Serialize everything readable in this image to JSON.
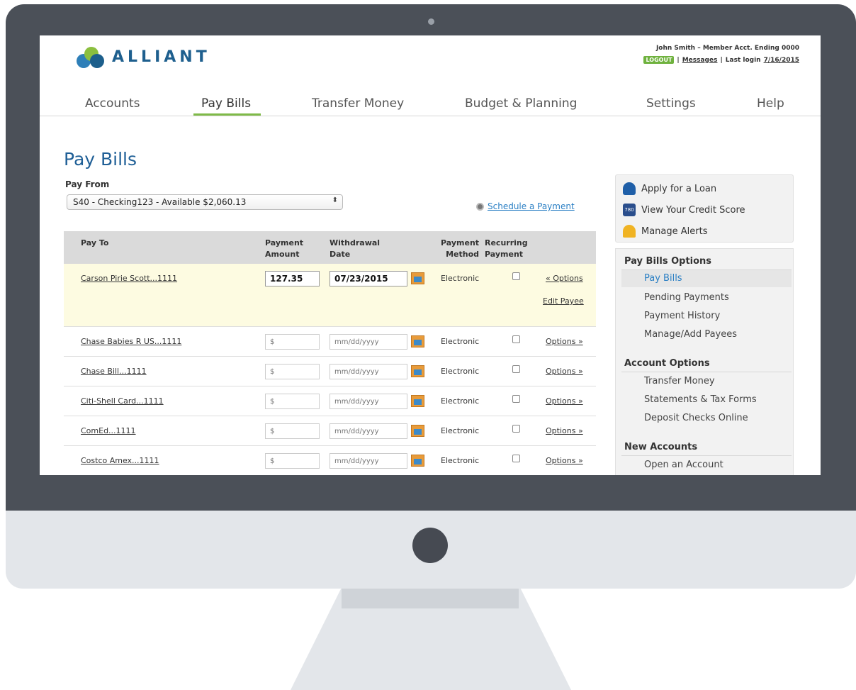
{
  "header": {
    "logo_text": "ALLIANT",
    "user_line": "John Smith – Member Acct. Ending 0000",
    "logout_label": "LOGOUT",
    "sep1": "|",
    "messages_label": "Messages",
    "sep2": "|",
    "last_login_label": "Last login",
    "last_login_date": "7/16/2015"
  },
  "nav": {
    "items": [
      "Accounts",
      "Pay Bills",
      "Transfer Money",
      "Budget & Planning",
      "Settings",
      "Help"
    ],
    "active": "Pay Bills"
  },
  "main": {
    "title": "Pay Bills",
    "pay_from_label": "Pay From",
    "pay_from_value": "S40 - Checking123 - Available $2,060.13",
    "select_arrow": "⬍",
    "schedule_label": "Schedule a Payment"
  },
  "table": {
    "headers": {
      "pay_to": "Pay To",
      "amount_1": "Payment",
      "amount_2": "Amount",
      "date_1": "Withdrawal",
      "date_2": "Date",
      "method_1": "Payment",
      "method_2": "Method",
      "recurring_1": "Recurring",
      "recurring_2": "Payment"
    },
    "amount_placeholder": "$",
    "date_placeholder": "mm/dd/yyyy",
    "rows": [
      {
        "payee": "Carson Pirie Scott...1111",
        "amount": "127.35",
        "date": "07/23/2015",
        "method": "Electronic",
        "options": "« Options",
        "edit": "Edit Payee"
      },
      {
        "payee": "Chase Babies R US...1111",
        "amount": "",
        "date": "",
        "method": "Electronic",
        "options": "Options »"
      },
      {
        "payee": "Chase Bill...1111",
        "amount": "",
        "date": "",
        "method": "Electronic",
        "options": "Options »"
      },
      {
        "payee": "Citi-Shell Card...1111",
        "amount": "",
        "date": "",
        "method": "Electronic",
        "options": "Options »"
      },
      {
        "payee": "ComEd...1111",
        "amount": "",
        "date": "",
        "method": "Electronic",
        "options": "Options »"
      },
      {
        "payee": "Costco Amex...1111",
        "amount": "",
        "date": "",
        "method": "Electronic",
        "options": "Options »"
      }
    ]
  },
  "sidebar": {
    "quick": {
      "loan": "Apply for a Loan",
      "credit": "View Your Credit Score",
      "credit_icon_text": "780",
      "alerts": "Manage Alerts"
    },
    "pay_bills_options": {
      "heading": "Pay Bills Options",
      "items": [
        "Pay Bills",
        "Pending Payments",
        "Payment History",
        "Manage/Add Payees"
      ]
    },
    "account_options": {
      "heading": "Account Options",
      "items": [
        "Transfer Money",
        "Statements & Tax Forms",
        "Deposit Checks Online"
      ]
    },
    "new_accounts": {
      "heading": "New Accounts",
      "items": [
        "Open an Account"
      ]
    }
  },
  "colors": {
    "brand_blue": "#1e5f8e",
    "accent_green": "#7fba48",
    "link_blue": "#2a7fc4",
    "selected_row": "#fdfbe1"
  }
}
